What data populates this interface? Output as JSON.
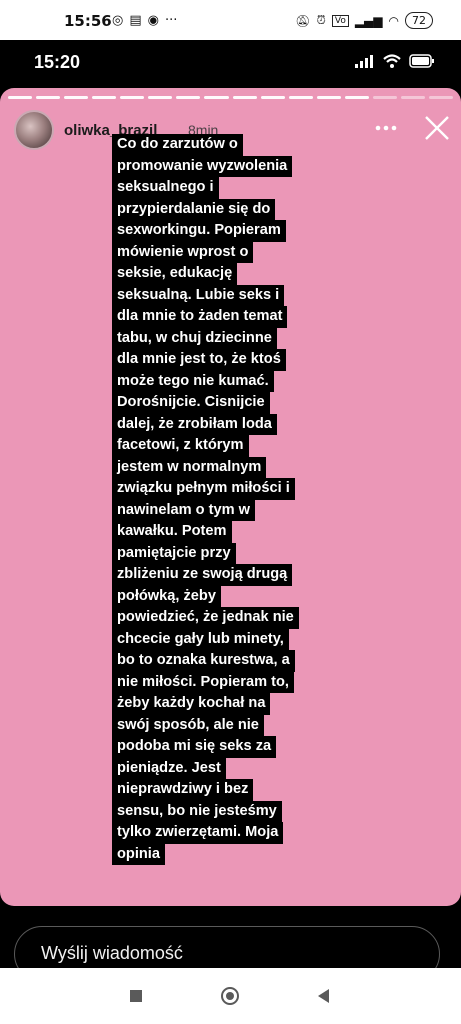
{
  "os_status": {
    "time": "15:56",
    "battery": "72"
  },
  "inner_status": {
    "time": "15:20"
  },
  "story": {
    "username": "oliwka_brazil",
    "time_ago": "8min",
    "progress_segments_total": 16,
    "progress_segments_viewed": 13,
    "background_color": "#eb97b7",
    "text_lines": [
      "Co do zarzutów o",
      "promowanie wyzwolenia",
      "seksualnego i",
      "przypierdalanie się do",
      "sexworkingu. Popieram",
      "mówienie wprost o",
      "seksie, edukację",
      "seksualną. Lubie seks i",
      "dla mnie to żaden temat",
      "tabu, w chuj dziecinne",
      "dla mnie jest to, że ktoś",
      "może tego nie kumać.",
      "Dorośnijcie. Cisnijcie",
      "dalej, że zrobiłam loda",
      "facetowi, z którym",
      "jestem w normalnym",
      "związku pełnym miłości i",
      "nawinelam o tym w",
      "kawałku. Potem",
      "pamiętajcie przy",
      "zbliżeniu ze swoją drugą",
      "połówką, żeby",
      "powiedzieć, że jednak nie",
      "chcecie gały lub minety,",
      "bo to oznaka kurestwa, a",
      "nie miłości. Popieram to,",
      "żeby każdy kochał na",
      "swój sposób, ale nie",
      "podoba mi się seks za",
      "pieniądze. Jest",
      "nieprawdziwy i bez",
      "sensu, bo nie jesteśmy",
      "tylko zwierzętami. Moja",
      "opinia"
    ]
  },
  "reply": {
    "placeholder": "Wyślij wiadomość"
  },
  "icons": {
    "more": "more-horizontal-icon",
    "close": "close-icon",
    "nav_recents": "square-icon",
    "nav_home": "circle-icon",
    "nav_back": "triangle-back-icon"
  }
}
